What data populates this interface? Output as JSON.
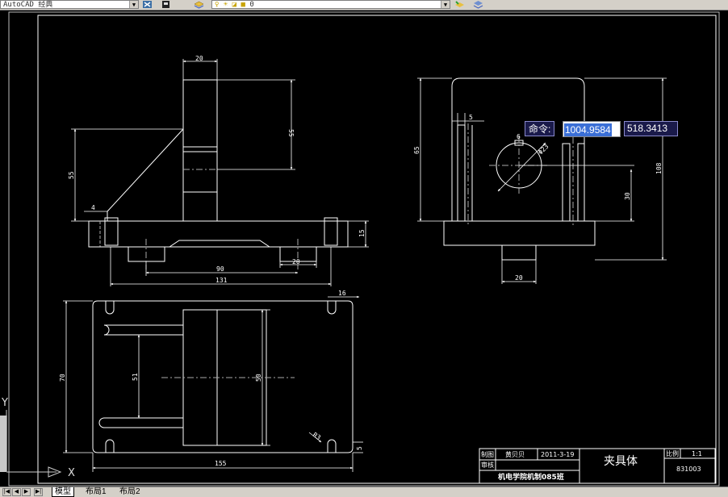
{
  "toolbar": {
    "workspace": "AutoCAD 经典",
    "layer": "0"
  },
  "drawing": {
    "front_view": {
      "dims": [
        "20",
        "55",
        "55",
        "4",
        "15",
        "90",
        "20",
        "131"
      ]
    },
    "side_view": {
      "dims": [
        "5",
        "6",
        "Φ23",
        "65",
        "108",
        "30",
        "20"
      ]
    },
    "top_view": {
      "dims": [
        "16",
        "70",
        "51",
        "50",
        "R3",
        "5",
        "155"
      ]
    },
    "title_block": {
      "part_name": "夹具体",
      "row1_label": "制图",
      "row1_name": "黄贝贝",
      "date": "2011-3-19",
      "row2_label": "审核",
      "scale_label": "比例",
      "scale_value": "1:1",
      "drawing_no": "831003",
      "school": "机电学院机制085班"
    }
  },
  "command": {
    "prompt": "命令:",
    "x": "1004.9584",
    "y": "518.3413"
  },
  "ucs": {
    "x_label": "X",
    "y_label": "Y"
  },
  "tabs": [
    "模型",
    "布局1",
    "布局2"
  ]
}
